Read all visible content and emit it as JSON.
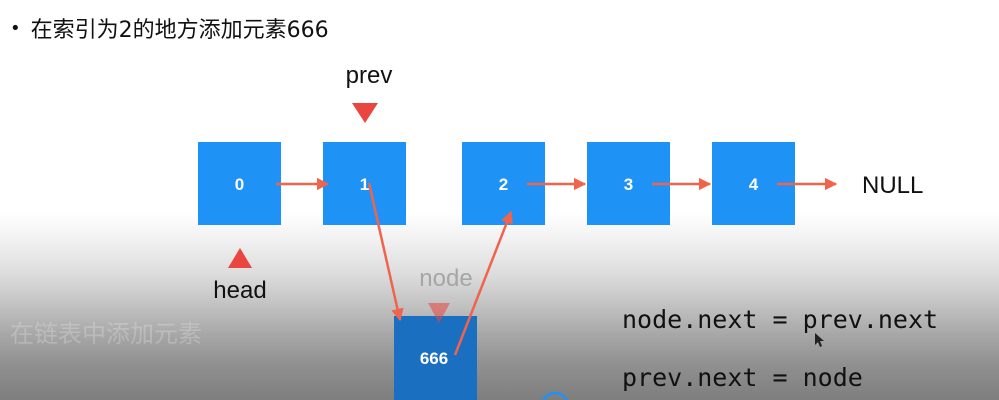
{
  "slide": {
    "heading": "在索引为2的地方添加元素666",
    "bullet": "•",
    "watermark": "在链表中添加元素"
  },
  "nodes": [
    {
      "id": "node-0",
      "value": "0"
    },
    {
      "id": "node-1",
      "value": "1"
    },
    {
      "id": "node-2",
      "value": "2"
    },
    {
      "id": "node-3",
      "value": "3"
    },
    {
      "id": "node-4",
      "value": "4"
    },
    {
      "id": "node-new",
      "value": "666"
    }
  ],
  "labels": {
    "null": "NULL",
    "prev": "prev",
    "head": "head",
    "node": "node"
  },
  "code": [
    "node.next = prev.next",
    "prev.next = node"
  ],
  "colors": {
    "node": "#1f93f5",
    "new_node": "#1b6fc0",
    "arrow": "#f0634c",
    "marker": "#e8463f"
  }
}
